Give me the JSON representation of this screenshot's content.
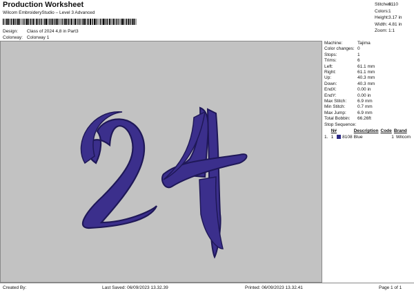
{
  "header": {
    "title": "Production Worksheet",
    "subtitle": "Wilcom EmbroideryStudio – Level 3 Advanced",
    "design_label": "Design:",
    "design_value": "Class of 2024 4,8 in Part3",
    "colorway_label": "Colorway:",
    "colorway_value": "Colorway 1"
  },
  "stats": {
    "stitches_label": "Stitches:",
    "stitches": "8110",
    "colors_label": "Colors:",
    "colors": "1",
    "height_label": "Height:",
    "height": "3.17 in",
    "width_label": "Width:",
    "width": "4.81 in",
    "zoom_label": "Zoom:",
    "zoom": "1:1"
  },
  "details": [
    {
      "k": "Machine:",
      "v": "Tajima"
    },
    {
      "k": "Color changes:",
      "v": "0"
    },
    {
      "k": "Stops:",
      "v": "1"
    },
    {
      "k": "Trims:",
      "v": "6"
    },
    {
      "k": "Left:",
      "v": "61.1 mm"
    },
    {
      "k": "Right:",
      "v": "61.1 mm"
    },
    {
      "k": "Up:",
      "v": "40.3 mm"
    },
    {
      "k": "Down:",
      "v": "40.3 mm"
    },
    {
      "k": "EndX:",
      "v": "0.00 in"
    },
    {
      "k": "EndY:",
      "v": "0.00 in"
    },
    {
      "k": "Max Stitch:",
      "v": "6.9 mm"
    },
    {
      "k": "Min Stitch:",
      "v": "0.7 mm"
    },
    {
      "k": "Max Jump:",
      "v": "6.9 mm"
    },
    {
      "k": "Total Bobbin:",
      "v": "66.26ft"
    }
  ],
  "sequence": {
    "title": "Stop Sequence:",
    "headers": {
      "no": "N#",
      "desc": "Description",
      "code": "Code",
      "brand": "Brand"
    },
    "rows": [
      {
        "n": "1.",
        "no": "1",
        "code": "8108",
        "desc": "Blue",
        "code2": "1",
        "brand": "Wilcom",
        "color": "#2c2a86"
      }
    ]
  },
  "design": {
    "text": "24",
    "thread_color": "#3b2f8c",
    "outline_color": "#1f1858",
    "stitch_highlight": "#8f84d6"
  },
  "footer": {
    "created": "Created By:",
    "saved": "Last Saved: 06/09/2023 13.32.39",
    "printed": "Printed: 06/09/2023 13.32.41",
    "page": "Page 1 of 1"
  }
}
